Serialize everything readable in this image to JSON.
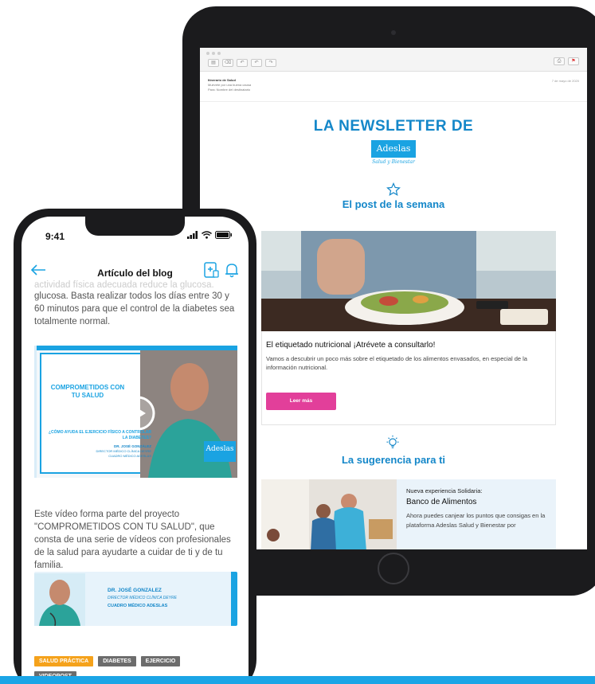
{
  "tablet": {
    "email": {
      "from": "Itinerario de Salud",
      "subject": "Muévete por una buena causa",
      "to": "Para: Nombre del destinatario",
      "date": "7 de mayo de 2020"
    },
    "newsletter": {
      "title": "LA NEWSLETTER DE",
      "brand": "Adeslas",
      "brand_tagline": "Salud y Bienestar",
      "post_section_title": "El post de la semana",
      "post_headline": "El etiquetado nutricional ¡Atrévete a consultarlo!",
      "post_description": "Vamos a descubrir un poco más sobre el etiquetado de los alimentos envasados, en especial de la información nutricional.",
      "post_button": "Leer más",
      "suggestion_section_title": "La sugerencia para ti",
      "suggestion_kicker": "Nueva experiencia Solidaria:",
      "suggestion_headline": "Banco de Alimentos",
      "suggestion_description": "Ahora puedes canjear los puntos que consigas en la plataforma Adeslas Salud y Bienestar por"
    }
  },
  "phone": {
    "status_time": "9:41",
    "header_title": "Artículo del blog",
    "faded_line": "actividad física adecuada reduce la glucosa.",
    "paragraph1": "glucosa. Basta realizar todos los días entre 30 y 60 minutos para que el control de la diabetes sea totalmente normal.",
    "video": {
      "campaign_title": "COMPROMETIDOS CON TU SALUD",
      "question": "¿CÓMO AYUDA EL EJERCICIO FÍSICO A CONTROLAR LA DIABETES?",
      "doctor_name": "DR. JOSÉ GONZÁLEZ",
      "doctor_role": "DIRECTOR MÉDICO CLÍNICA DEYRE",
      "doctor_org": "CUADRO MÉDICO ADESLAS",
      "brand": "Adeslas"
    },
    "paragraph2": "Este vídeo forma parte del proyecto \"COMPROMETIDOS CON TU SALUD\", que consta de una serie de vídeos con profesionales de la salud para ayudarte a cuidar de ti y de tu familia.",
    "doctor_card": {
      "name": "DR. JOSÉ GONZALEZ",
      "role": "DIRECTOR MÉDICO CLÍNICA DEYRE",
      "org": "CUADRO MÉDICO ADESLAS"
    },
    "tags": [
      "SALUD PRÁCTICA",
      "DIABETES",
      "EJERCICIO",
      "VIDEOPOST"
    ]
  },
  "colors": {
    "accent_blue": "#1487c9",
    "brand_blue": "#1aa3e2",
    "button_pink": "#e23f9a",
    "tag_orange": "#f5a21b",
    "tag_gray": "#6c6c6c"
  }
}
